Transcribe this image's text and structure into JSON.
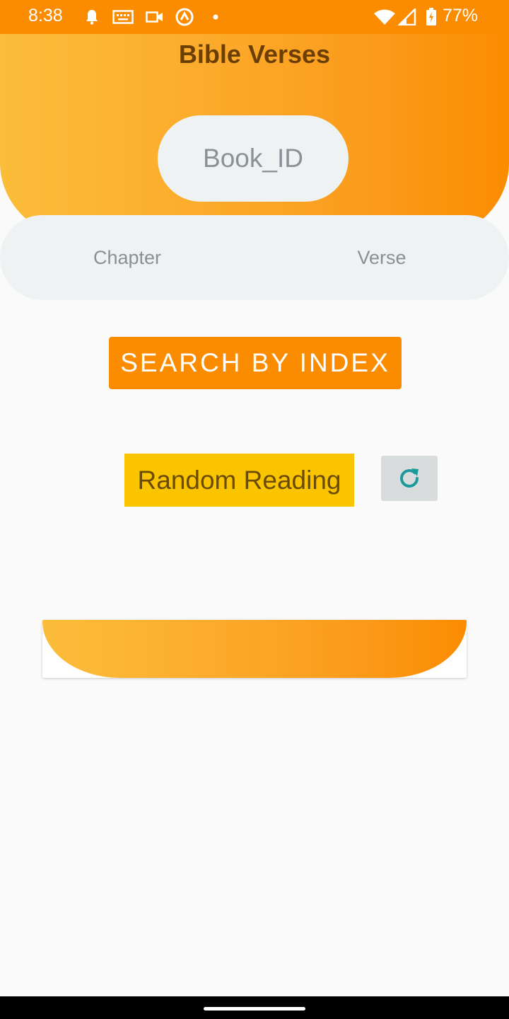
{
  "status_bar": {
    "time": "8:38",
    "battery": "77%",
    "icons": [
      "bell-icon",
      "keyboard-icon",
      "video-icon",
      "sync-icon",
      "dot-icon",
      "wifi-icon",
      "signal-icon",
      "battery-icon"
    ],
    "color": "#fb8c00"
  },
  "header": {
    "title": "Bible Verses",
    "book_placeholder": "Book_ID"
  },
  "fields": {
    "chapter_placeholder": "Chapter",
    "verse_placeholder": "Verse"
  },
  "actions": {
    "search_label": "SEARCH BY INDEX",
    "random_label": "Random Reading",
    "refresh_icon": "refresh-icon"
  },
  "colors": {
    "accent": "#fb8c00",
    "gradient_start": "#fbbd3a",
    "random_bg": "#fbc400",
    "refresh_icon": "#1a9a9a",
    "title_text": "#6a3e05"
  }
}
